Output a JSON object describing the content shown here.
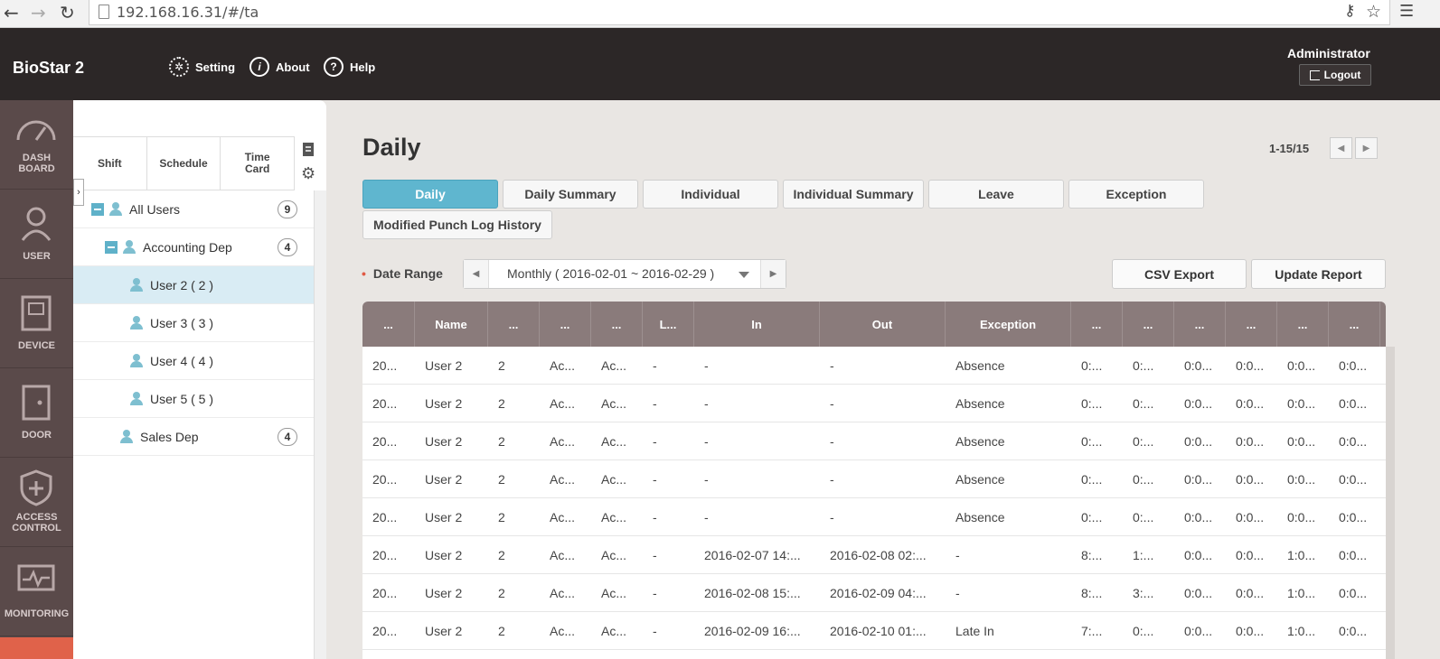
{
  "browser": {
    "url": "192.168.16.31/#/ta"
  },
  "header": {
    "brand": "BioStar 2",
    "links": [
      {
        "icon": "gear-icon",
        "label": "Setting"
      },
      {
        "icon": "info-icon",
        "label": "About"
      },
      {
        "icon": "help-icon",
        "label": "Help"
      }
    ],
    "user": "Administrator",
    "logout_label": "Logout"
  },
  "side_nav": [
    {
      "icon": "gauge-icon",
      "label_line1": "DASH",
      "label_line2": "BOARD"
    },
    {
      "icon": "user-icon",
      "label_line1": "USER",
      "label_line2": ""
    },
    {
      "icon": "device-icon",
      "label_line1": "DEVICE",
      "label_line2": ""
    },
    {
      "icon": "door-icon",
      "label_line1": "DOOR",
      "label_line2": ""
    },
    {
      "icon": "shield-plus-icon",
      "label_line1": "ACCESS",
      "label_line2": "CONTROL"
    },
    {
      "icon": "monitor-pulse-icon",
      "label_line1": "MONITORING",
      "label_line2": ""
    }
  ],
  "tree": {
    "tabs": [
      {
        "line1": "Shift",
        "line2": ""
      },
      {
        "line1": "Schedule",
        "line2": ""
      },
      {
        "line1": "Time",
        "line2": "Card"
      }
    ],
    "items": [
      {
        "label": "All Users",
        "count": "9"
      },
      {
        "label": "Accounting Dep",
        "count": "4"
      },
      {
        "label": "User 2 ( 2 )",
        "count": ""
      },
      {
        "label": "User 3 ( 3 )",
        "count": ""
      },
      {
        "label": "User 4 ( 4 )",
        "count": ""
      },
      {
        "label": "User 5 ( 5 )",
        "count": ""
      },
      {
        "label": "Sales Dep",
        "count": "4"
      }
    ]
  },
  "main": {
    "title": "Daily",
    "pager": "1-15/15",
    "report_tabs": [
      "Daily",
      "Daily Summary",
      "Individual",
      "Individual Summary",
      "Leave",
      "Exception",
      "Modified Punch Log History"
    ],
    "active_tab": "Daily",
    "date_range_label": "Date Range",
    "date_range_value": "Monthly ( 2016-02-01 ~ 2016-02-29 )",
    "csv_export_label": "CSV Export",
    "update_report_label": "Update Report"
  },
  "table": {
    "columns": [
      "...",
      "Name",
      "...",
      "...",
      "...",
      "L...",
      "In",
      "Out",
      "Exception",
      "...",
      "...",
      "...",
      "...",
      "...",
      "..."
    ],
    "rows": [
      [
        "20...",
        "User 2",
        "2",
        "Ac...",
        "Ac...",
        "-",
        "-",
        "-",
        "Absence",
        "0:...",
        "0:...",
        "0:0...",
        "0:0...",
        "0:0...",
        "0:0..."
      ],
      [
        "20...",
        "User 2",
        "2",
        "Ac...",
        "Ac...",
        "-",
        "-",
        "-",
        "Absence",
        "0:...",
        "0:...",
        "0:0...",
        "0:0...",
        "0:0...",
        "0:0..."
      ],
      [
        "20...",
        "User 2",
        "2",
        "Ac...",
        "Ac...",
        "-",
        "-",
        "-",
        "Absence",
        "0:...",
        "0:...",
        "0:0...",
        "0:0...",
        "0:0...",
        "0:0..."
      ],
      [
        "20...",
        "User 2",
        "2",
        "Ac...",
        "Ac...",
        "-",
        "-",
        "-",
        "Absence",
        "0:...",
        "0:...",
        "0:0...",
        "0:0...",
        "0:0...",
        "0:0..."
      ],
      [
        "20...",
        "User 2",
        "2",
        "Ac...",
        "Ac...",
        "-",
        "-",
        "-",
        "Absence",
        "0:...",
        "0:...",
        "0:0...",
        "0:0...",
        "0:0...",
        "0:0..."
      ],
      [
        "20...",
        "User 2",
        "2",
        "Ac...",
        "Ac...",
        "-",
        "2016-02-07 14:...",
        "2016-02-08 02:...",
        "-",
        "8:...",
        "1:...",
        "0:0...",
        "0:0...",
        "1:0...",
        "0:0..."
      ],
      [
        "20...",
        "User 2",
        "2",
        "Ac...",
        "Ac...",
        "-",
        "2016-02-08 15:...",
        "2016-02-09 04:...",
        "-",
        "8:...",
        "3:...",
        "0:0...",
        "0:0...",
        "1:0...",
        "0:0..."
      ],
      [
        "20...",
        "User 2",
        "2",
        "Ac...",
        "Ac...",
        "-",
        "2016-02-09 16:...",
        "2016-02-10 01:...",
        "Late In",
        "7:...",
        "0:...",
        "0:0...",
        "0:0...",
        "1:0...",
        "0:0..."
      ]
    ]
  }
}
